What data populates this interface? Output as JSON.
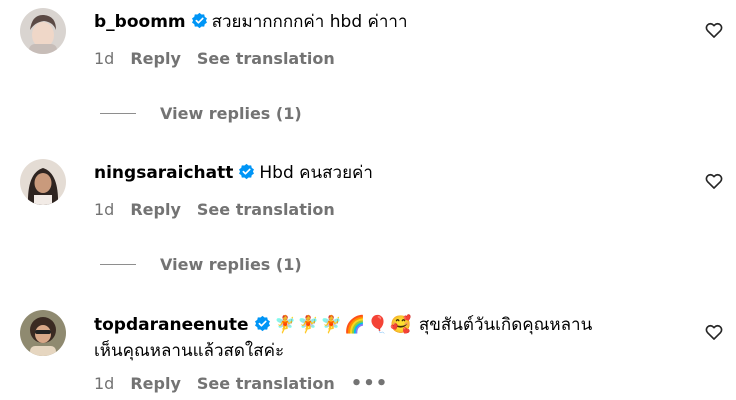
{
  "comments": [
    {
      "username": "b_boomm",
      "text": "สวยมากกกกค่า hbd ค่าาา",
      "age": "1d",
      "reply_label": "Reply",
      "translate_label": "See translation",
      "view_replies_label": "View replies (1)"
    },
    {
      "username": "ningsaraichatt",
      "text": "Hbd คนสวยค่า",
      "age": "1d",
      "reply_label": "Reply",
      "translate_label": "See translation",
      "view_replies_label": "View replies (1)"
    },
    {
      "username": "topdaraneenute",
      "emojis": "🧚🧚🧚🌈🎈🥰",
      "text": "สุขสันต์วันเกิดคุณหลาน",
      "text_line2": "เห็นคุณหลานแล้วสดใสค่ะ",
      "age": "1d",
      "reply_label": "Reply",
      "translate_label": "See translation",
      "more_label": "•••"
    }
  ],
  "icons": {
    "verified": "verified-badge-icon",
    "like": "heart-outline-icon"
  },
  "colors": {
    "verified_blue": "#0095f6",
    "secondary_text": "#737373"
  }
}
